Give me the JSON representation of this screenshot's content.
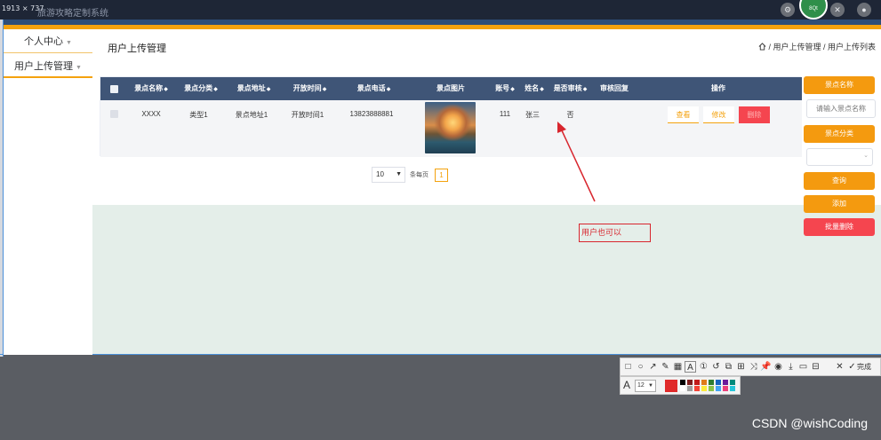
{
  "titlebar": {
    "dimensions": "1913 × 737",
    "system_name": "旅游攻略定制系统",
    "avatar_label": "8Qt"
  },
  "sidebar": {
    "items": [
      {
        "label": "个人中心"
      },
      {
        "label": "用户上传管理"
      }
    ]
  },
  "header": {
    "page_title": "用户上传管理",
    "breadcrumb": "/ 用户上传管理 / 用户上传列表"
  },
  "table": {
    "columns": [
      "景点名称",
      "景点分类",
      "景点地址",
      "开放时间",
      "景点电话",
      "景点图片",
      "账号",
      "姓名",
      "是否审核",
      "审核回复",
      "操作"
    ],
    "rows": [
      {
        "name": "XXXX",
        "category": "类型1",
        "address": "景点地址1",
        "open_time": "开放时间1",
        "phone": "13823888881",
        "account": "111",
        "person": "张三",
        "reviewed": "否",
        "reply": ""
      }
    ],
    "actions": {
      "view": "查看",
      "edit": "修改",
      "delete": "删除"
    }
  },
  "pagination": {
    "page_size": "10",
    "per_page_label": "条每页",
    "current_page": "1"
  },
  "right_panel": {
    "name_label": "景点名称",
    "name_placeholder": "请输入景点名称",
    "category_label": "景点分类",
    "search": "查询",
    "add": "添加",
    "batch_delete": "批量删除"
  },
  "annotation": {
    "text": "用户也可以"
  },
  "snip_toolbar": {
    "done_label": "完成",
    "font_size": "12",
    "current_color": "#e02a2a",
    "palette": [
      "#000000",
      "#7f1d1d",
      "#c21a1a",
      "#e07b1a",
      "#2e7d32",
      "#1565c0",
      "#6a1b9a",
      "#00897b",
      "#ffffff",
      "#9e9e9e",
      "#f44336",
      "#ffeb3b",
      "#8bc34a",
      "#42a5f5",
      "#ec407a",
      "#26c6da"
    ]
  },
  "watermark": "CSDN @wishCoding"
}
